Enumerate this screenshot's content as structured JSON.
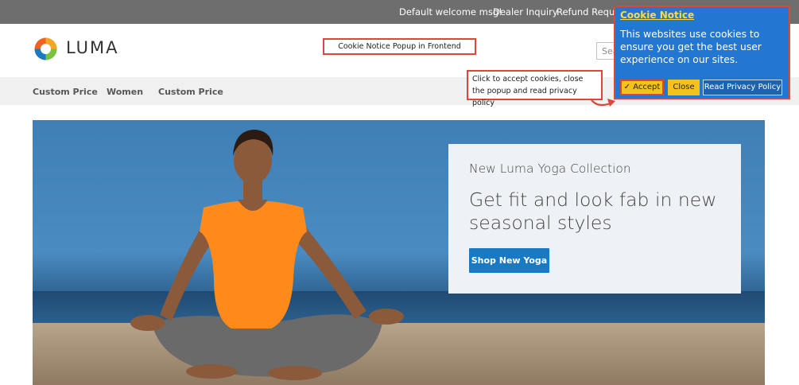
{
  "topbar": {
    "welcome": "Default welcome msg!",
    "dealer": "Dealer Inquiry",
    "refund": "Refund Reques"
  },
  "header": {
    "logo_text": "LUMA",
    "search_placeholder": "Sea"
  },
  "nav": {
    "items": [
      {
        "label": "Custom Price"
      },
      {
        "label": "Women"
      },
      {
        "label": "Custom Price"
      }
    ]
  },
  "annotations": {
    "title": "Cookie Notice Popup in Frontend",
    "hint": "Click to accept cookies, close the popup and read privacy policy"
  },
  "hero": {
    "subtitle": "New Luma Yoga Collection",
    "headline": "Get fit and look fab in new seasonal styles",
    "button": "Shop New Yoga"
  },
  "cookie": {
    "title": "Cookie Notice",
    "body": "This websites use cookies to ensure you get the best user experience on our sites.",
    "accept": "✓ Accept",
    "close": "Close",
    "privacy": "Read Privacy Policy"
  },
  "colors": {
    "accent": "#1979c3",
    "popup": "#2177d1",
    "button_yellow": "#f5c21b",
    "annotation_border": "#e0453a"
  }
}
